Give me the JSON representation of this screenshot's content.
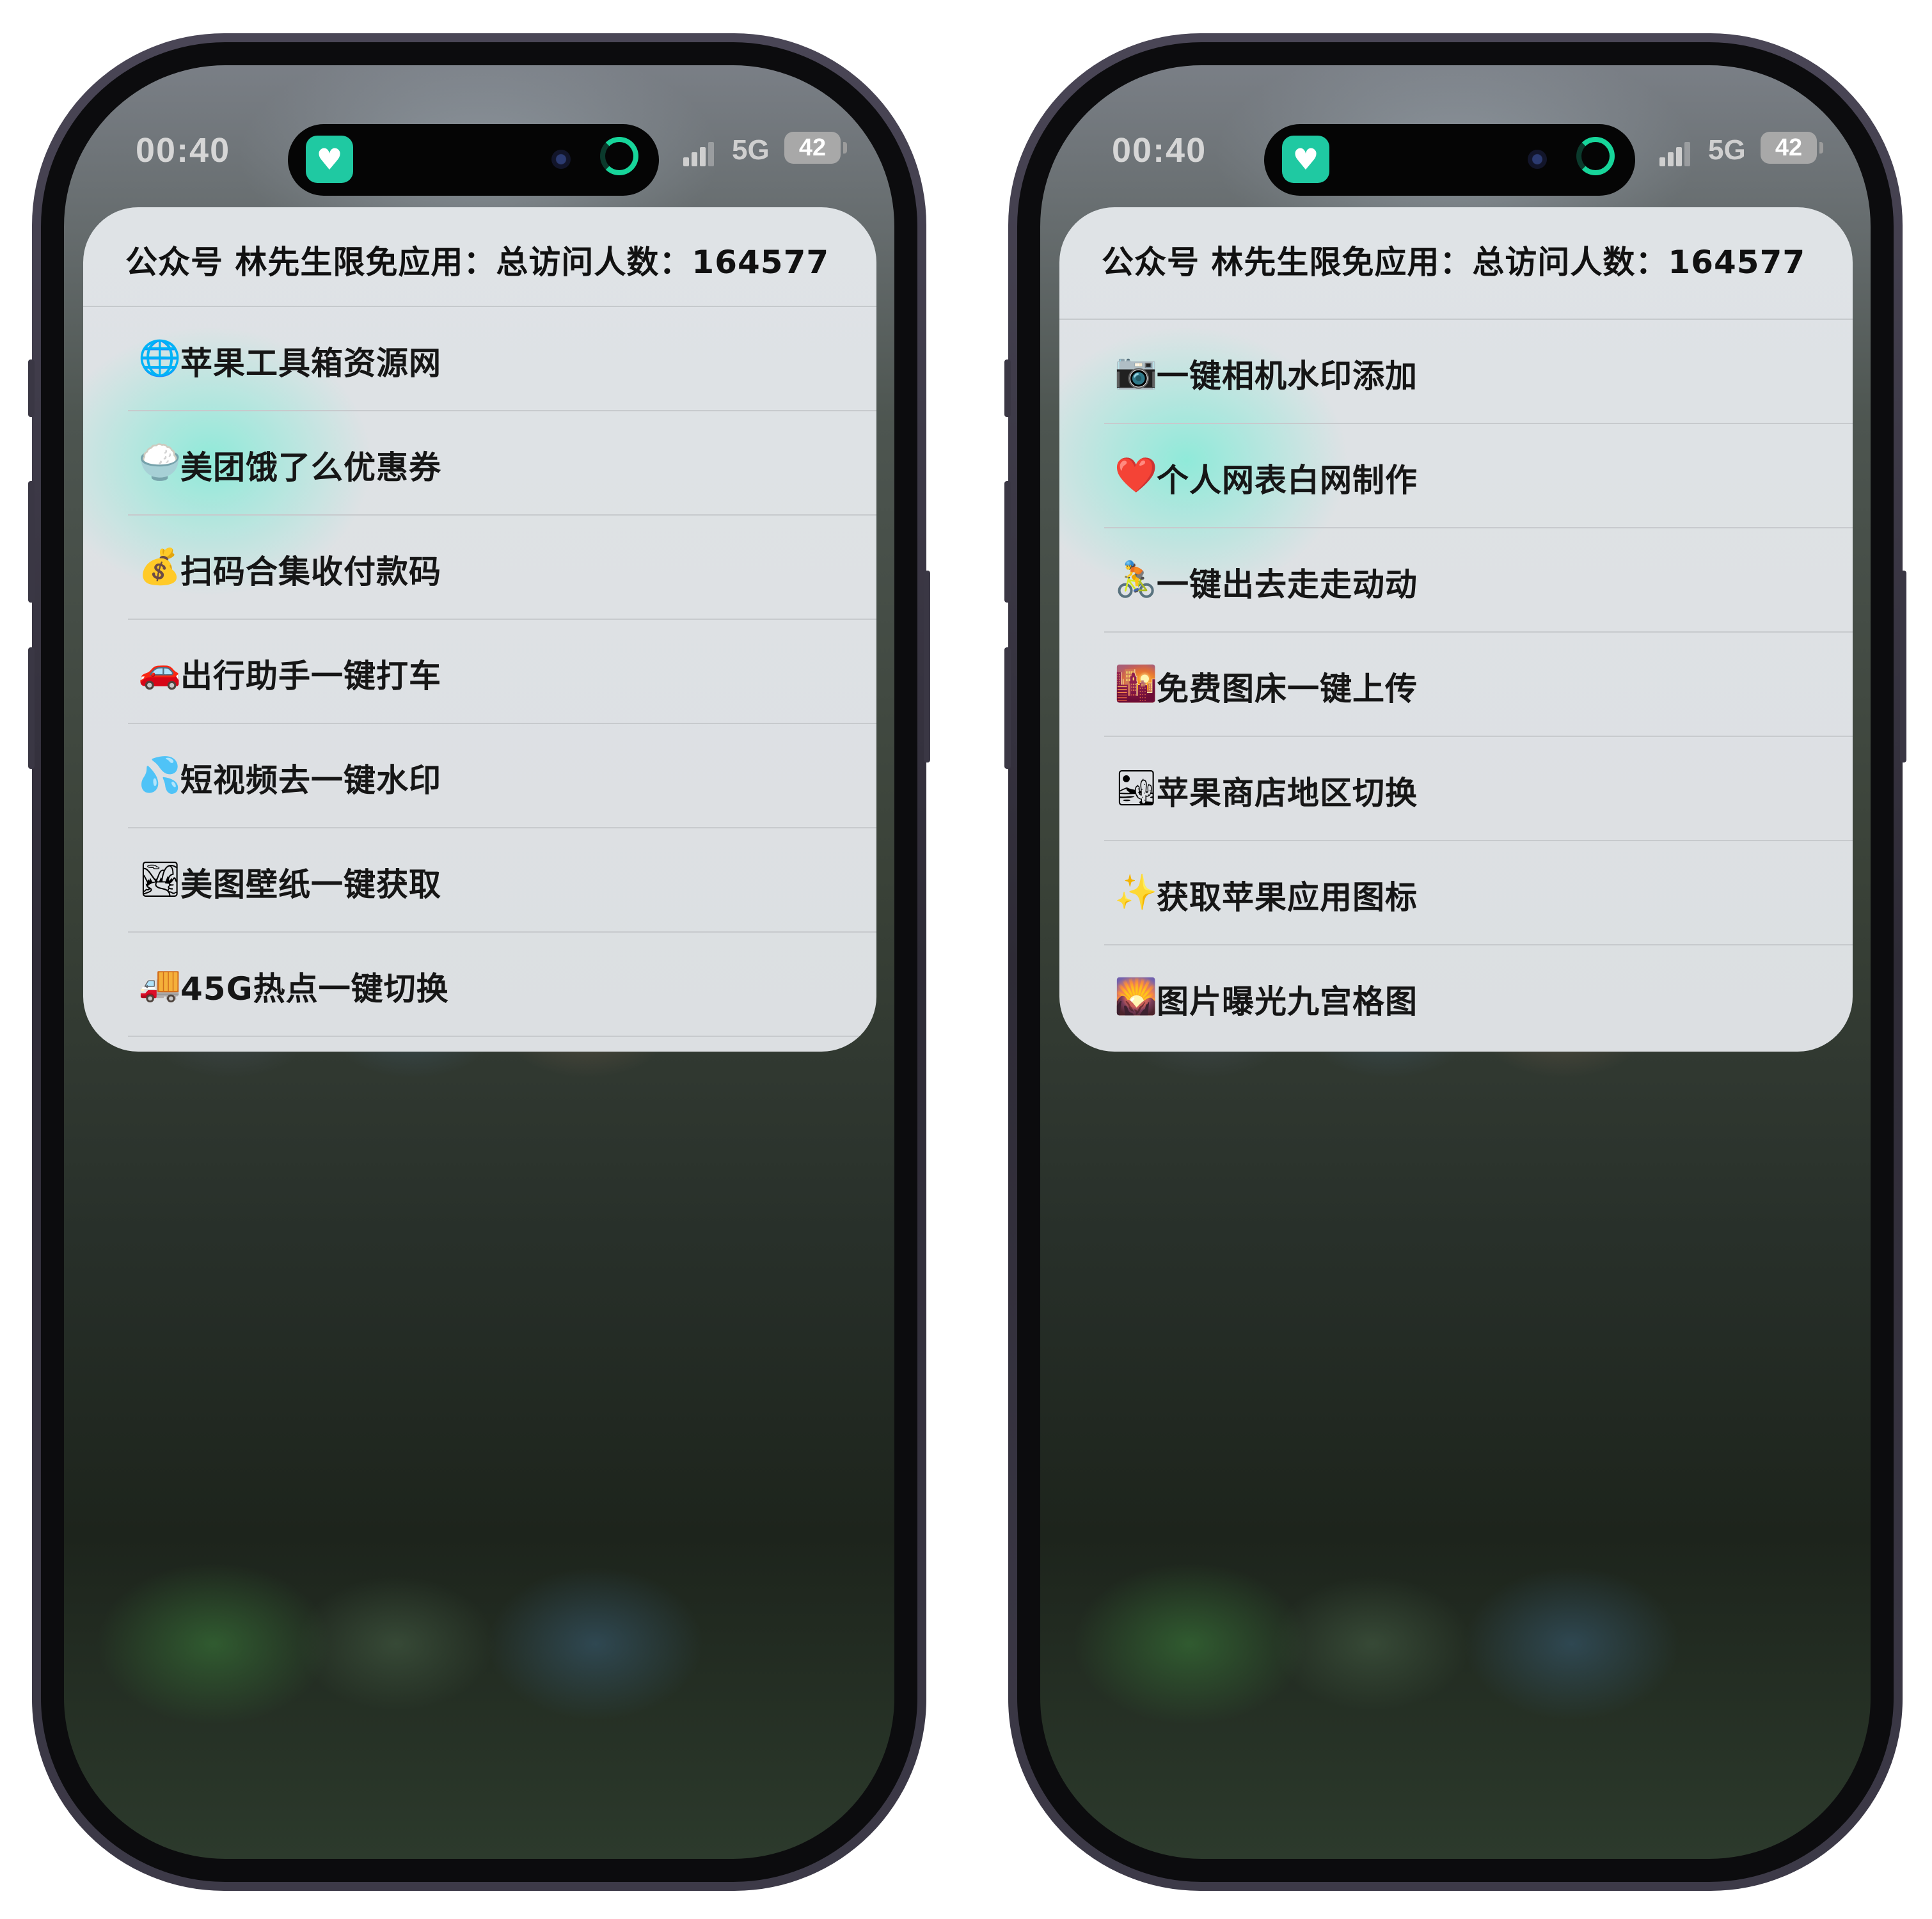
{
  "colors": {
    "widget_bg": "#dfe3e6",
    "app_icon_green": "#1fc9a2",
    "ring_green": "#17d59a",
    "text": "#161616"
  },
  "phones": [
    {
      "status": {
        "time": "00:40",
        "network": "5G",
        "battery": "42"
      },
      "widget": {
        "title": "公众号 林先生限免应用：总访问人数：164577",
        "items": [
          {
            "icon": "🌐",
            "label": "苹果工具箱资源网"
          },
          {
            "icon": "🍚",
            "label": "美团饿了么优惠券"
          },
          {
            "icon": "💰",
            "label": "扫码合集收付款码"
          },
          {
            "icon": "🚗",
            "label": "出行助手一键打车"
          },
          {
            "icon": "💦",
            "label": "短视频去一键水印"
          },
          {
            "icon": "🏞",
            "label": "美图壁纸一键获取"
          },
          {
            "icon": "🚚",
            "label": "45G热点一键切换"
          }
        ]
      }
    },
    {
      "status": {
        "time": "00:40",
        "network": "5G",
        "battery": "42"
      },
      "widget": {
        "title": "公众号 林先生限免应用：总访问人数：164577",
        "items": [
          {
            "icon": "📷",
            "label": "一键相机水印添加"
          },
          {
            "icon": "❤️",
            "label": "个人网表白网制作"
          },
          {
            "icon": "🚴",
            "label": "一键出去走走动动"
          },
          {
            "icon": "🌇",
            "label": "免费图床一键上传"
          },
          {
            "icon": "🏜",
            "label": "苹果商店地区切换"
          },
          {
            "icon": "✨",
            "label": "获取苹果应用图标"
          },
          {
            "icon": "🌄",
            "label": "图片曝光九宫格图"
          }
        ]
      }
    }
  ]
}
